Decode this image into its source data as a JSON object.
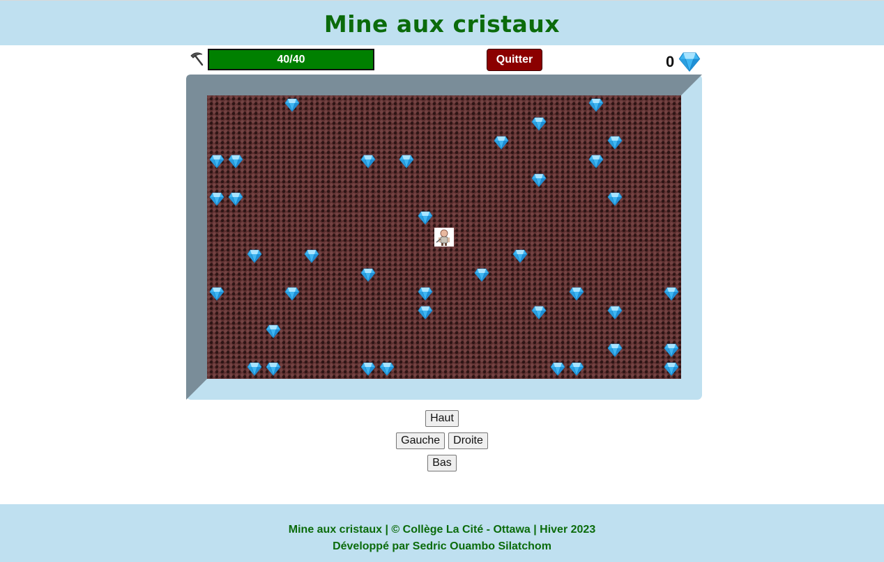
{
  "header": {
    "title": "Mine aux cristaux"
  },
  "status": {
    "tool_icon": "pickaxe-icon",
    "energy_label": "40/40",
    "energy_current": 40,
    "energy_max": 40,
    "quit_label": "Quitter",
    "score": "0",
    "score_icon": "gem-icon"
  },
  "grid": {
    "cols": 25,
    "rows": 15,
    "miner": [
      12,
      7
    ],
    "crystals": [
      [
        4,
        0
      ],
      [
        20,
        0
      ],
      [
        17,
        1
      ],
      [
        15,
        2
      ],
      [
        21,
        2
      ],
      [
        0,
        3
      ],
      [
        1,
        3
      ],
      [
        8,
        3
      ],
      [
        10,
        3
      ],
      [
        20,
        3
      ],
      [
        17,
        4
      ],
      [
        0,
        5
      ],
      [
        1,
        5
      ],
      [
        21,
        5
      ],
      [
        11,
        6
      ],
      [
        2,
        8
      ],
      [
        5,
        8
      ],
      [
        16,
        8
      ],
      [
        8,
        9
      ],
      [
        14,
        9
      ],
      [
        0,
        10
      ],
      [
        4,
        10
      ],
      [
        11,
        10
      ],
      [
        19,
        10
      ],
      [
        24,
        10
      ],
      [
        11,
        11
      ],
      [
        17,
        11
      ],
      [
        21,
        11
      ],
      [
        3,
        12
      ],
      [
        21,
        13
      ],
      [
        24,
        13
      ],
      [
        2,
        14
      ],
      [
        3,
        14
      ],
      [
        8,
        14
      ],
      [
        9,
        14
      ],
      [
        18,
        14
      ],
      [
        19,
        14
      ],
      [
        24,
        14
      ]
    ]
  },
  "controls": {
    "up": "Haut",
    "left": "Gauche",
    "right": "Droite",
    "down": "Bas"
  },
  "footer": {
    "line1": "Mine aux cristaux | © Collège La Cité - Ottawa | Hiver 2023",
    "line2": "Développé par Sedric Ouambo Silatchom"
  },
  "colors": {
    "header_bg": "#bfe0f0",
    "title": "#0b6b0b",
    "energy": "#008000",
    "quit": "#8b0000",
    "rock": "#5a2d2d",
    "frame_dark": "#7a8d99",
    "frame_light": "#bfe0f0"
  }
}
